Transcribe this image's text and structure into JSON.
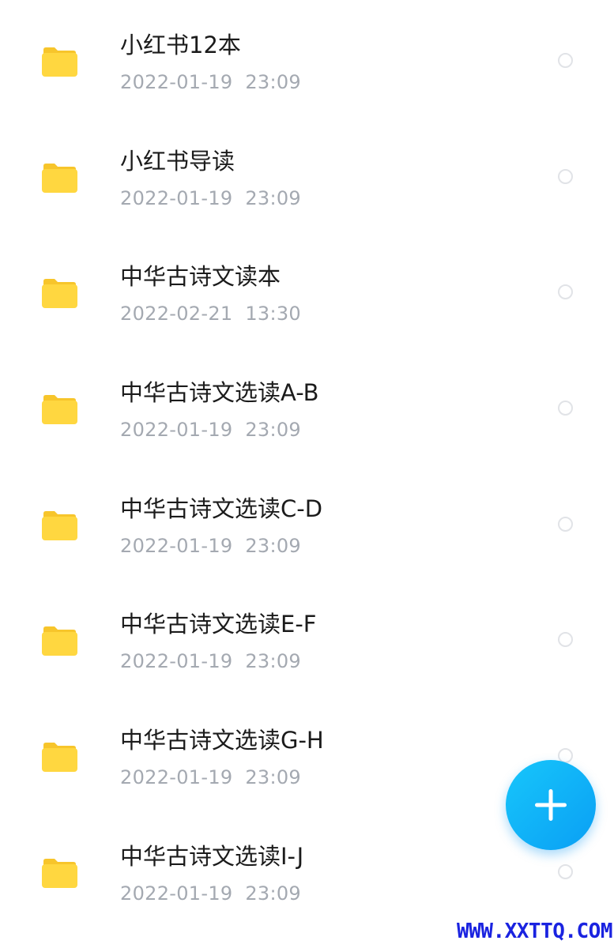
{
  "colors": {
    "folder": "#ffd740",
    "folder_tab": "#f7c52b",
    "name_text": "#1b1b1b",
    "date_text": "#a4a9b1",
    "radio_border": "#e1e3e7",
    "fab_start": "#17c6fb",
    "fab_end": "#0a9ff4",
    "watermark": "#1a23e0"
  },
  "files": [
    {
      "icon": "folder-icon",
      "name": "小红书12本",
      "date": "2022-01-19  23:09"
    },
    {
      "icon": "folder-icon",
      "name": "小红书导读",
      "date": "2022-01-19  23:09"
    },
    {
      "icon": "folder-icon",
      "name": "中华古诗文读本",
      "date": "2022-02-21  13:30"
    },
    {
      "icon": "folder-icon",
      "name": "中华古诗文选读A-B",
      "date": "2022-01-19  23:09"
    },
    {
      "icon": "folder-icon",
      "name": "中华古诗文选读C-D",
      "date": "2022-01-19  23:09"
    },
    {
      "icon": "folder-icon",
      "name": "中华古诗文选读E-F",
      "date": "2022-01-19  23:09"
    },
    {
      "icon": "folder-icon",
      "name": "中华古诗文选读G-H",
      "date": "2022-01-19  23:09"
    },
    {
      "icon": "folder-icon",
      "name": "中华古诗文选读I-J",
      "date": "2022-01-19  23:09"
    }
  ],
  "fab": {
    "icon": "plus-icon"
  },
  "watermark": {
    "text": "WWW.XXTTQ.COM"
  }
}
